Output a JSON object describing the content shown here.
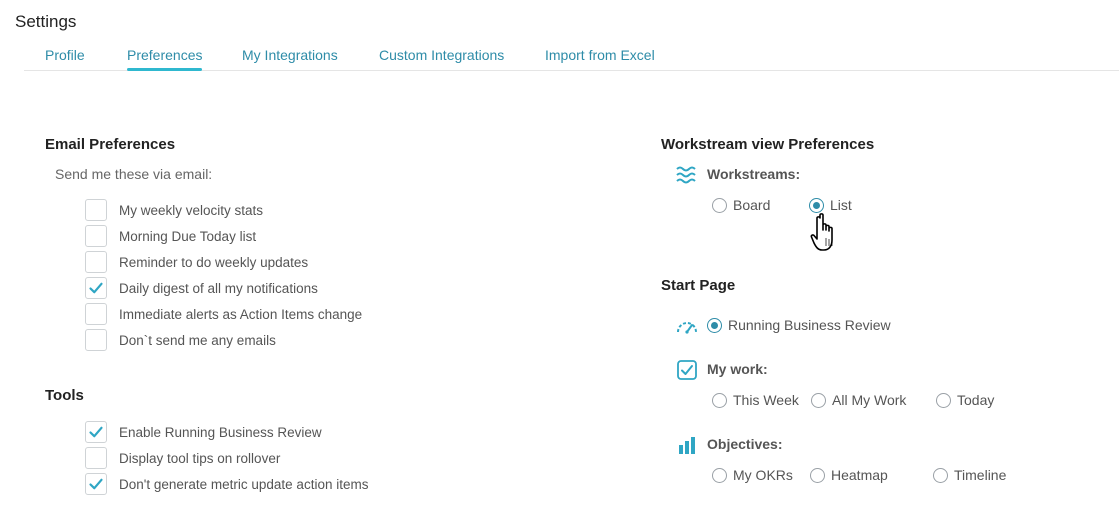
{
  "page": {
    "title": "Settings"
  },
  "tabs": [
    {
      "label": "Profile"
    },
    {
      "label": "Preferences",
      "active": true
    },
    {
      "label": "My Integrations"
    },
    {
      "label": "Custom Integrations"
    },
    {
      "label": "Import from Excel"
    }
  ],
  "email": {
    "title": "Email Preferences",
    "subtitle": "Send me these via email:",
    "options": [
      {
        "label": "My weekly velocity stats",
        "checked": false
      },
      {
        "label": "Morning Due Today list",
        "checked": false
      },
      {
        "label": "Reminder to do weekly updates",
        "checked": false
      },
      {
        "label": "Daily digest of all my notifications",
        "checked": true
      },
      {
        "label": "Immediate alerts as Action Items change",
        "checked": false
      },
      {
        "label": "Don`t send me any emails",
        "checked": false
      }
    ]
  },
  "tools": {
    "title": "Tools",
    "options": [
      {
        "label": "Enable Running Business Review",
        "checked": true
      },
      {
        "label": "Display tool tips on rollover",
        "checked": false
      },
      {
        "label": "Don't generate metric update action items",
        "checked": true
      }
    ]
  },
  "workstream": {
    "title": "Workstream view Preferences",
    "label": "Workstreams:",
    "icon": "workstreams-icon",
    "options": [
      {
        "label": "Board",
        "checked": false
      },
      {
        "label": "List",
        "checked": true
      }
    ]
  },
  "start_page": {
    "title": "Start Page",
    "running_review": {
      "label": "Running Business Review",
      "checked": true,
      "icon": "gauge-icon"
    },
    "my_work": {
      "label": "My work:",
      "icon": "checkbox-icon",
      "options": [
        {
          "label": "This Week",
          "checked": false
        },
        {
          "label": "All My Work",
          "checked": false
        },
        {
          "label": "Today",
          "checked": false
        }
      ]
    },
    "objectives": {
      "label": "Objectives:",
      "icon": "bar-chart-icon",
      "options": [
        {
          "label": "My OKRs",
          "checked": false
        },
        {
          "label": "Heatmap",
          "checked": false
        },
        {
          "label": "Timeline",
          "checked": false
        }
      ]
    }
  },
  "colors": {
    "accent": "#2e8ca8",
    "tab_underline": "#2fb8cf",
    "check": "#2fa6c4"
  }
}
